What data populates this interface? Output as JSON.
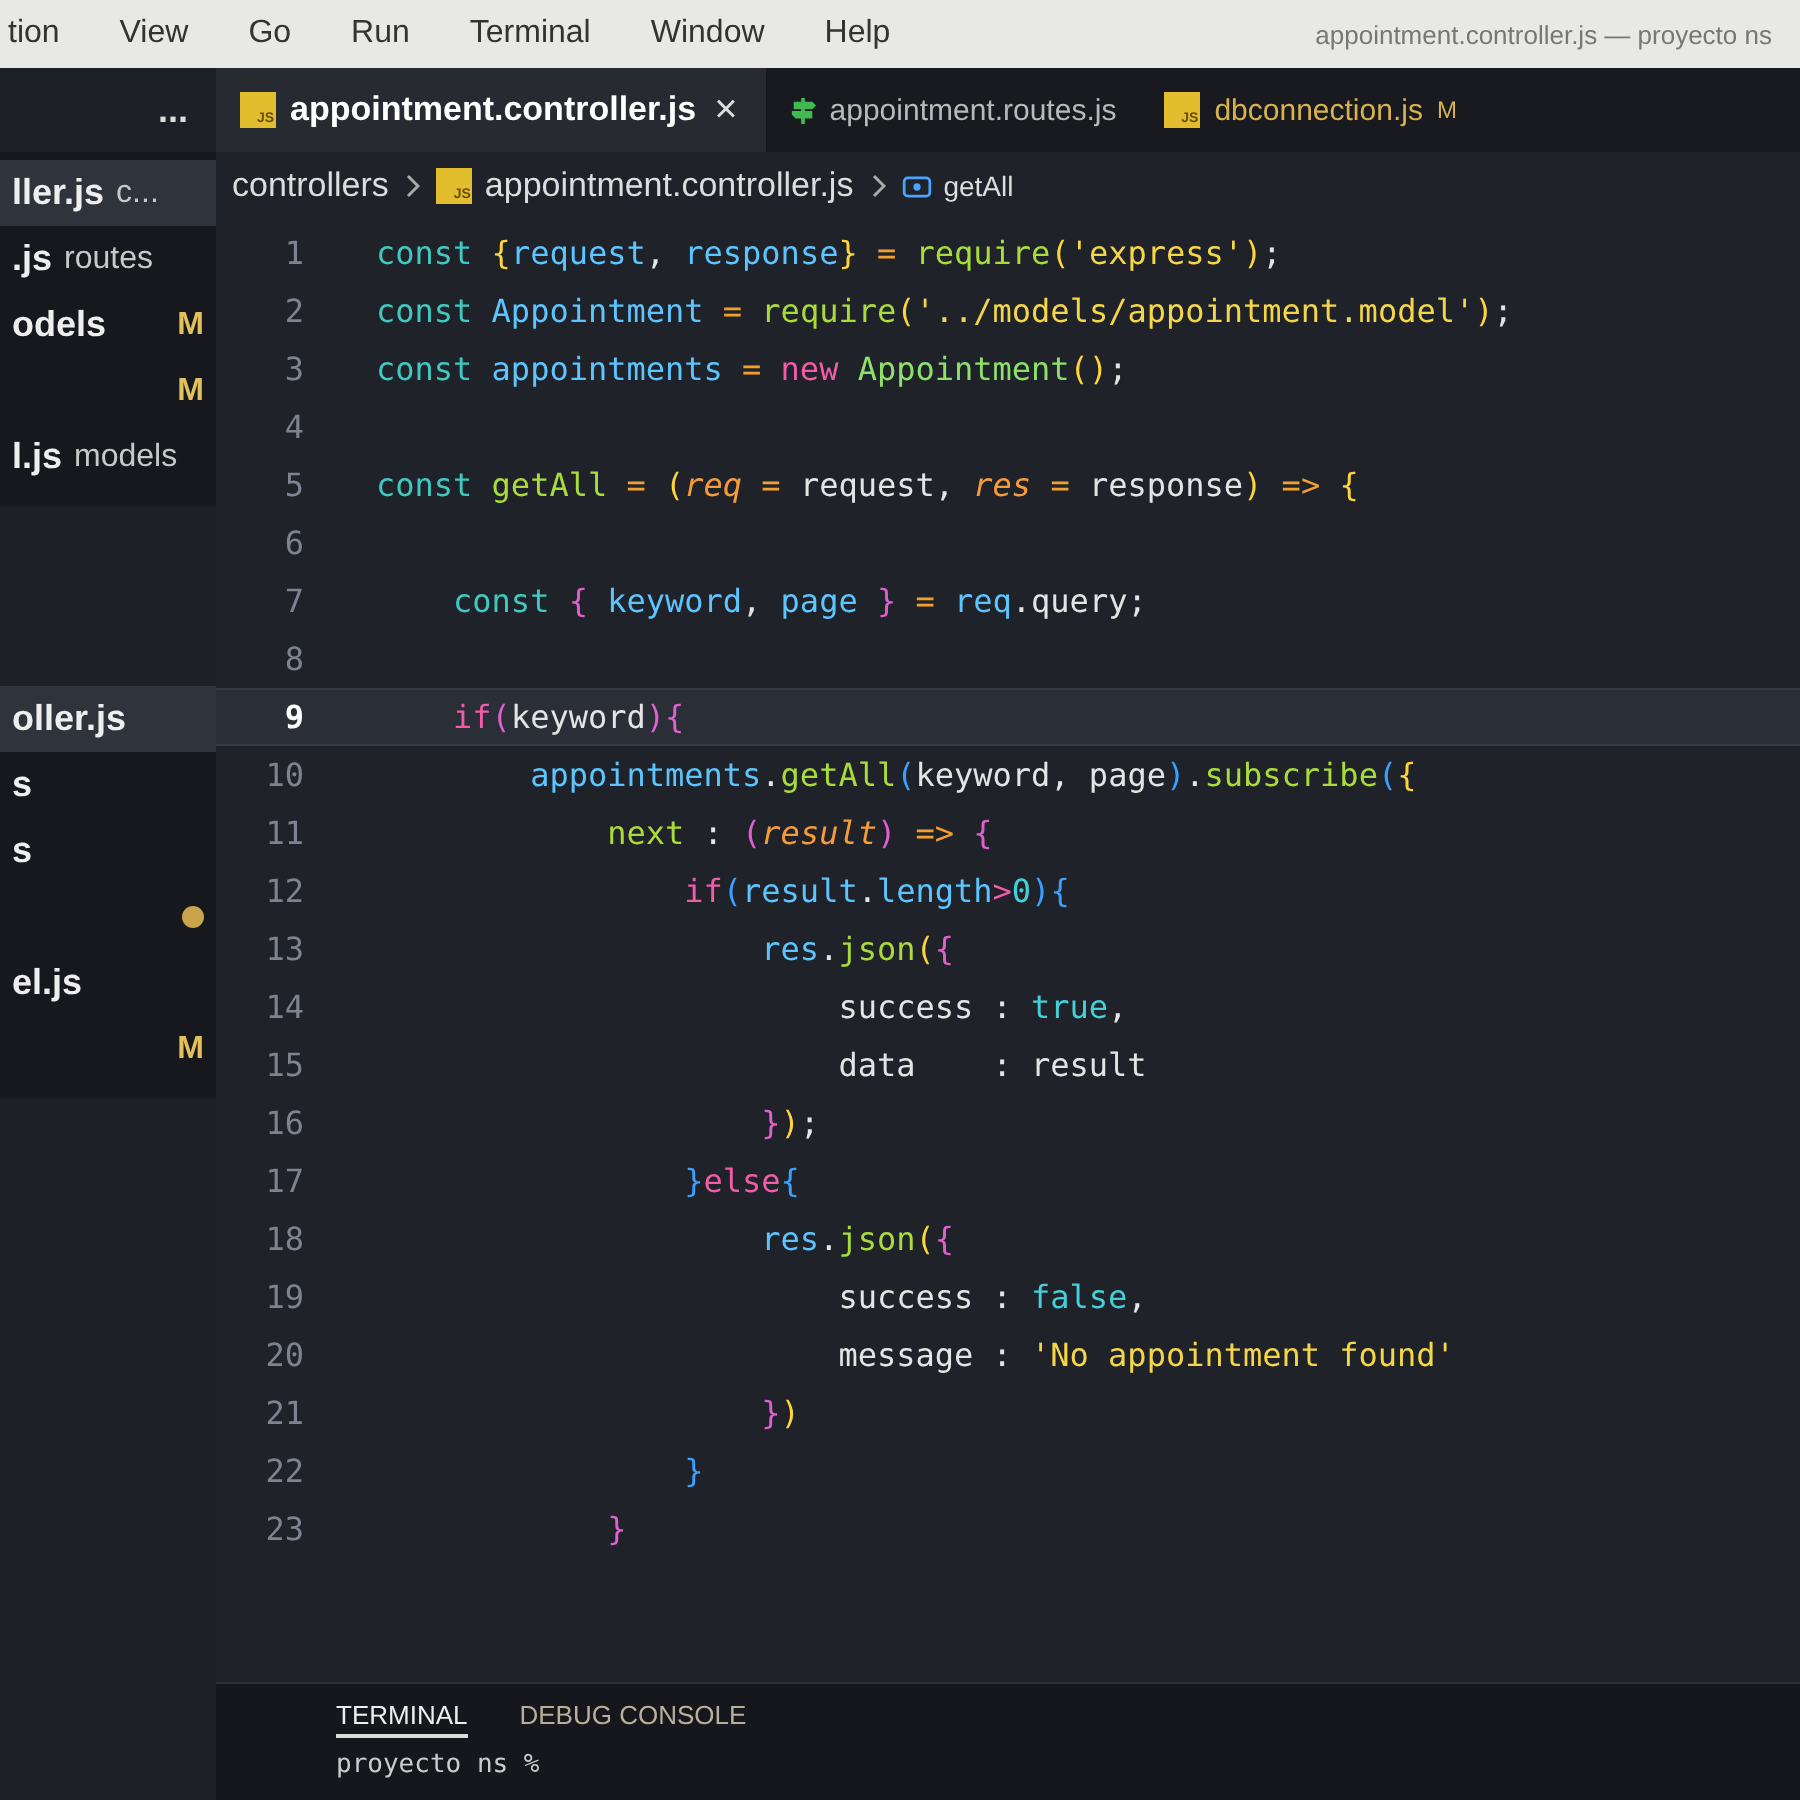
{
  "menu_bar": {
    "items": [
      "tion",
      "View",
      "Go",
      "Run",
      "Terminal",
      "Window",
      "Help"
    ]
  },
  "window_title": "appointment.controller.js — proyecto ns",
  "sidebar": {
    "more": "...",
    "open_editors": [
      {
        "name": "ller.js",
        "detail": "c...",
        "selected": true
      },
      {
        "name": ".js",
        "detail": "routes",
        "selected": false
      },
      {
        "name": "odels",
        "badge": "M",
        "selected": false
      },
      {
        "badge": "M",
        "selected": false
      },
      {
        "name": "l.js",
        "detail": "models",
        "selected": false
      }
    ],
    "explorer": [
      {
        "kind": "file",
        "name": "oller.js",
        "selected": true
      },
      {
        "kind": "file",
        "name": "s",
        "selected": false
      },
      {
        "kind": "file",
        "name": "s",
        "selected": false
      },
      {
        "kind": "dot",
        "selected": false
      },
      {
        "kind": "file",
        "name": "el.js",
        "selected": false
      },
      {
        "kind": "file",
        "badge": "M",
        "selected": false
      }
    ]
  },
  "tabs": [
    {
      "kind": "js",
      "icon_label": "JS",
      "label": "appointment.controller.js",
      "close": "×",
      "selected": true
    },
    {
      "kind": "route",
      "label": "appointment.routes.js",
      "selected": false
    },
    {
      "kind": "js",
      "icon_label": "JS",
      "label": "dbconnection.js",
      "badge": "M",
      "selected": false
    }
  ],
  "breadcrumb": [
    {
      "kind": "folder",
      "label": "controllers"
    },
    {
      "kind": "file",
      "icon_label": "JS",
      "label": "appointment.controller.js"
    },
    {
      "kind": "symbol",
      "label": "getAll"
    }
  ],
  "code": [
    {
      "number": "1",
      "current": false,
      "tokens": [
        {
          "kind": "kw",
          "text": "const "
        },
        {
          "kind": "b1",
          "text": "{"
        },
        {
          "kind": "var",
          "text": "request"
        },
        {
          "kind": "p",
          "text": ", "
        },
        {
          "kind": "var",
          "text": "response"
        },
        {
          "kind": "b1",
          "text": "}"
        },
        {
          "kind": "op",
          "text": " = "
        },
        {
          "kind": "fn",
          "text": "require"
        },
        {
          "kind": "b1",
          "text": "("
        },
        {
          "kind": "str",
          "text": "'express'"
        },
        {
          "kind": "b1",
          "text": ")"
        },
        {
          "kind": "p",
          "text": ";"
        }
      ]
    },
    {
      "number": "2",
      "current": false,
      "tokens": [
        {
          "kind": "kw",
          "text": "const "
        },
        {
          "kind": "var",
          "text": "Appointment"
        },
        {
          "kind": "op",
          "text": " = "
        },
        {
          "kind": "fn",
          "text": "require"
        },
        {
          "kind": "b1",
          "text": "("
        },
        {
          "kind": "str",
          "text": "'../models/appointment.model'"
        },
        {
          "kind": "b1",
          "text": ")"
        },
        {
          "kind": "p",
          "text": ";"
        }
      ]
    },
    {
      "number": "3",
      "current": false,
      "tokens": [
        {
          "kind": "kw",
          "text": "const "
        },
        {
          "kind": "var",
          "text": "appointments"
        },
        {
          "kind": "op",
          "text": " = "
        },
        {
          "kind": "new",
          "text": "new "
        },
        {
          "kind": "cls",
          "text": "Appointment"
        },
        {
          "kind": "b1",
          "text": "()"
        },
        {
          "kind": "p",
          "text": ";"
        }
      ]
    },
    {
      "number": "4",
      "current": false
    },
    {
      "number": "5",
      "current": false,
      "tokens": [
        {
          "kind": "kw",
          "text": "const "
        },
        {
          "kind": "fn",
          "text": "getAll"
        },
        {
          "kind": "op",
          "text": " = "
        },
        {
          "kind": "b1",
          "text": "("
        },
        {
          "kind": "param",
          "text": "req"
        },
        {
          "kind": "op",
          "text": " = "
        },
        {
          "kind": "p",
          "text": "request, "
        },
        {
          "kind": "param",
          "text": "res"
        },
        {
          "kind": "op",
          "text": " = "
        },
        {
          "kind": "p",
          "text": "response"
        },
        {
          "kind": "b1",
          "text": ")"
        },
        {
          "kind": "op",
          "text": " => "
        },
        {
          "kind": "b1",
          "text": "{"
        }
      ],
      "children": [
        {
          "number": "6",
          "current": false
        },
        {
          "number": "7",
          "current": false,
          "tokens": [
            {
              "kind": "kw",
              "text": "const "
            },
            {
              "kind": "b2",
              "text": "{ "
            },
            {
              "kind": "var",
              "text": "keyword"
            },
            {
              "kind": "p",
              "text": ", "
            },
            {
              "kind": "var",
              "text": "page"
            },
            {
              "kind": "b2",
              "text": " }"
            },
            {
              "kind": "op",
              "text": " = "
            },
            {
              "kind": "var",
              "text": "req"
            },
            {
              "kind": "p",
              "text": ".query;"
            }
          ]
        },
        {
          "number": "8",
          "current": false
        },
        {
          "number": "9",
          "current": true,
          "tokens": [
            {
              "kind": "new",
              "text": "if"
            },
            {
              "kind": "b2",
              "text": "("
            },
            {
              "kind": "p",
              "text": "keyword"
            },
            {
              "kind": "b2",
              "text": ")"
            },
            {
              "kind": "b2",
              "text": "{"
            }
          ],
          "children": [
            {
              "number": "10",
              "current": false,
              "tokens": [
                {
                  "kind": "var",
                  "text": "appointments"
                },
                {
                  "kind": "p",
                  "text": "."
                },
                {
                  "kind": "fn",
                  "text": "getAll"
                },
                {
                  "kind": "b3",
                  "text": "("
                },
                {
                  "kind": "p",
                  "text": "keyword, page"
                },
                {
                  "kind": "b3",
                  "text": ")"
                },
                {
                  "kind": "p",
                  "text": "."
                },
                {
                  "kind": "fn",
                  "text": "subscribe"
                },
                {
                  "kind": "b3",
                  "text": "("
                },
                {
                  "kind": "b1",
                  "text": "{"
                }
              ],
              "children": [
                {
                  "number": "11",
                  "current": false,
                  "tokens": [
                    {
                      "kind": "fn",
                      "text": "next"
                    },
                    {
                      "kind": "p",
                      "text": " : "
                    },
                    {
                      "kind": "b2",
                      "text": "("
                    },
                    {
                      "kind": "param",
                      "text": "result"
                    },
                    {
                      "kind": "b2",
                      "text": ")"
                    },
                    {
                      "kind": "op",
                      "text": " => "
                    },
                    {
                      "kind": "b2",
                      "text": "{"
                    }
                  ],
                  "children": [
                    {
                      "number": "12",
                      "current": false,
                      "tokens": [
                        {
                          "kind": "new",
                          "text": "if"
                        },
                        {
                          "kind": "b3",
                          "text": "("
                        },
                        {
                          "kind": "var",
                          "text": "result"
                        },
                        {
                          "kind": "p",
                          "text": "."
                        },
                        {
                          "kind": "var",
                          "text": "length"
                        },
                        {
                          "kind": "new",
                          "text": ">"
                        },
                        {
                          "kind": "bool",
                          "text": "0"
                        },
                        {
                          "kind": "b3",
                          "text": ")"
                        },
                        {
                          "kind": "b3",
                          "text": "{"
                        }
                      ],
                      "children": [
                        {
                          "number": "13",
                          "current": false,
                          "tokens": [
                            {
                              "kind": "var",
                              "text": "res"
                            },
                            {
                              "kind": "p",
                              "text": "."
                            },
                            {
                              "kind": "fn",
                              "text": "json"
                            },
                            {
                              "kind": "b1",
                              "text": "("
                            },
                            {
                              "kind": "b2",
                              "text": "{"
                            }
                          ],
                          "children": [
                            {
                              "number": "14",
                              "current": false,
                              "tokens": [
                                {
                                  "kind": "p",
                                  "text": "success : "
                                },
                                {
                                  "kind": "bool",
                                  "text": "true"
                                },
                                {
                                  "kind": "p",
                                  "text": ","
                                }
                              ]
                            },
                            {
                              "number": "15",
                              "current": false,
                              "tokens": [
                                {
                                  "kind": "p",
                                  "text": "data    : result"
                                }
                              ]
                            }
                          ]
                        },
                        {
                          "number": "16",
                          "current": false,
                          "tokens": [
                            {
                              "kind": "b2",
                              "text": "}"
                            },
                            {
                              "kind": "b1",
                              "text": ")"
                            },
                            {
                              "kind": "p",
                              "text": ";"
                            }
                          ]
                        }
                      ]
                    },
                    {
                      "number": "17",
                      "current": false,
                      "tokens": [
                        {
                          "kind": "b3",
                          "text": "}"
                        },
                        {
                          "kind": "new",
                          "text": "else"
                        },
                        {
                          "kind": "b3",
                          "text": "{"
                        }
                      ],
                      "children": [
                        {
                          "number": "18",
                          "current": false,
                          "tokens": [
                            {
                              "kind": "var",
                              "text": "res"
                            },
                            {
                              "kind": "p",
                              "text": "."
                            },
                            {
                              "kind": "fn",
                              "text": "json"
                            },
                            {
                              "kind": "b1",
                              "text": "("
                            },
                            {
                              "kind": "b2",
                              "text": "{"
                            }
                          ],
                          "children": [
                            {
                              "number": "19",
                              "current": false,
                              "tokens": [
                                {
                                  "kind": "p",
                                  "text": "success : "
                                },
                                {
                                  "kind": "bool",
                                  "text": "false"
                                },
                                {
                                  "kind": "p",
                                  "text": ","
                                }
                              ]
                            },
                            {
                              "number": "20",
                              "current": false,
                              "tokens": [
                                {
                                  "kind": "p",
                                  "text": "message : "
                                },
                                {
                                  "kind": "str",
                                  "text": "'No appointment found'"
                                }
                              ]
                            }
                          ]
                        },
                        {
                          "number": "21",
                          "current": false,
                          "tokens": [
                            {
                              "kind": "b2",
                              "text": "}"
                            },
                            {
                              "kind": "b1",
                              "text": ")"
                            }
                          ]
                        }
                      ]
                    },
                    {
                      "number": "22",
                      "current": false,
                      "tokens": [
                        {
                          "kind": "b3",
                          "text": "}"
                        }
                      ]
                    }
                  ]
                },
                {
                  "number": "23",
                  "current": false,
                  "tokens": [
                    {
                      "kind": "b2",
                      "text": "}"
                    }
                  ]
                }
              ]
            }
          ]
        }
      ]
    }
  ],
  "panel": {
    "tabs": [
      {
        "label": "TERMINAL",
        "selected": true
      },
      {
        "label": "DEBUG CONSOLE",
        "selected": false
      }
    ],
    "terminal_line": "proyecto ns %"
  }
}
